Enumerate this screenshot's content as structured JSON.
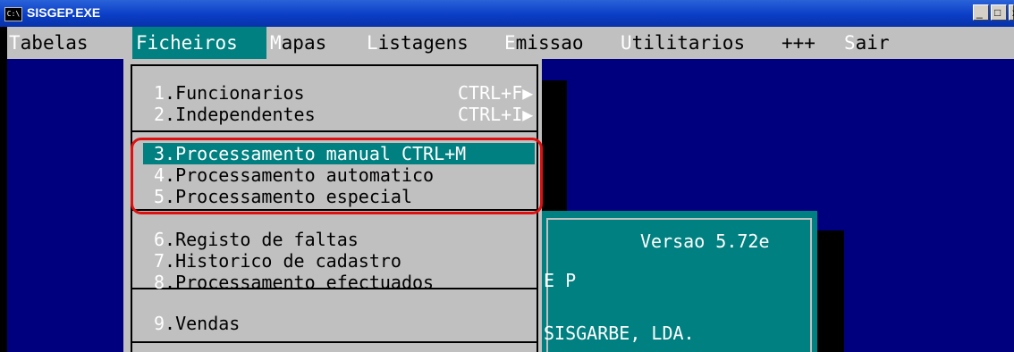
{
  "window": {
    "title": "SISGEP.EXE",
    "icon": "console-icon",
    "icon_text": "C:\\"
  },
  "window_buttons": [
    {
      "name": "minimize-button",
      "glyph": "_"
    },
    {
      "name": "maximize-button",
      "glyph": "□"
    },
    {
      "name": "close-button",
      "glyph": "x"
    }
  ],
  "menubar": [
    {
      "hotkey": "T",
      "rest": "abelas"
    },
    {
      "hotkey": "F",
      "rest": "icheiros"
    },
    {
      "hotkey": "M",
      "rest": "apas"
    },
    {
      "hotkey": "L",
      "rest": "istagens"
    },
    {
      "hotkey": "E",
      "rest": "missao"
    },
    {
      "hotkey": "U",
      "rest": "tilitarios"
    },
    {
      "hotkey": "",
      "rest": "+++"
    },
    {
      "hotkey": "S",
      "rest": "air"
    }
  ],
  "dropdown": {
    "groups": [
      [
        {
          "num": "1",
          "label": ".Funcionarios",
          "shortcut": "CTRL+F▶"
        },
        {
          "num": "2",
          "label": ".Independentes",
          "shortcut": "CTRL+I▶"
        }
      ],
      [
        {
          "num": "3",
          "label": ".Processamento manual CTRL+M",
          "shortcut": ""
        },
        {
          "num": "4",
          "label": ".Processamento automatico",
          "shortcut": ""
        },
        {
          "num": "5",
          "label": ".Processamento especial",
          "shortcut": ""
        }
      ],
      [
        {
          "num": "6",
          "label": ".Registo de faltas",
          "shortcut": ""
        },
        {
          "num": "7",
          "label": ".Historico de cadastro",
          "shortcut": ""
        },
        {
          "num": "8",
          "label": ".Processamento efectuados",
          "shortcut": ""
        }
      ],
      [
        {
          "num": "9",
          "label": ".Vendas",
          "shortcut": ""
        }
      ]
    ]
  },
  "infobox": {
    "version": "Versao 5.72e",
    "fragment": "E P",
    "company": "SISGARBE, LDA."
  },
  "colors": {
    "console_bg": "#00007f",
    "menu_bg": "#c0c0c0",
    "teal": "#008080",
    "annotation_red": "#e01010"
  }
}
